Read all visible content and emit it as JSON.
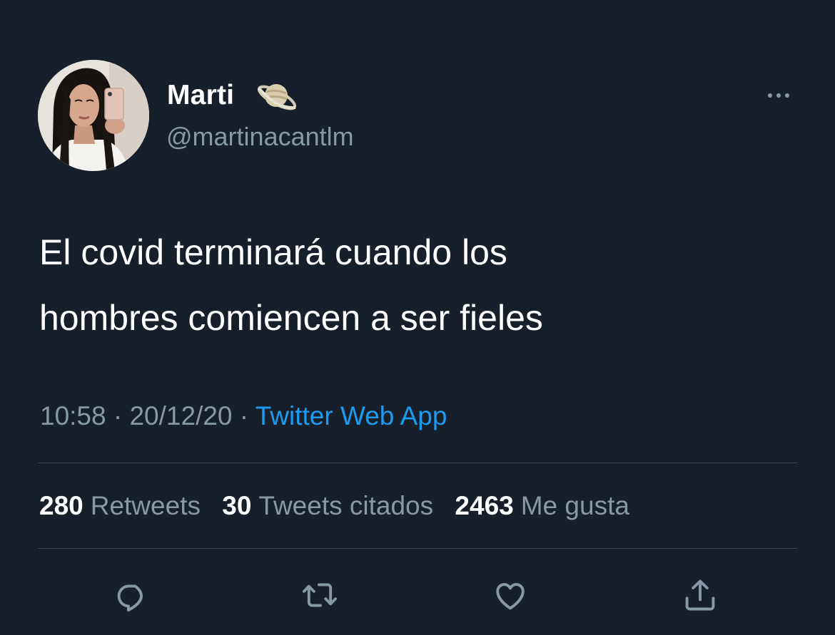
{
  "user": {
    "display_name": "Marti",
    "name_emoji": "planet-emoji",
    "handle": "@martinacantlm",
    "avatar_icon": "profile-photo"
  },
  "tweet": {
    "text": "El covid terminará cuando los\nhombres comiencen a ser fieles",
    "time": "10:58",
    "separator": " · ",
    "date": "20/12/20",
    "source": "Twitter Web App"
  },
  "stats": {
    "retweets_count": "280",
    "retweets_label": "Retweets",
    "quotes_count": "30",
    "quotes_label": "Tweets citados",
    "likes_count": "2463",
    "likes_label": "Me gusta"
  },
  "actions": [
    "reply-icon",
    "retweet-icon",
    "like-icon",
    "share-icon"
  ],
  "colors": {
    "background": "#171f2a",
    "text_primary": "#ffffff",
    "text_secondary": "#8899a6",
    "link": "#1d9bf0",
    "divider": "#38444d"
  }
}
